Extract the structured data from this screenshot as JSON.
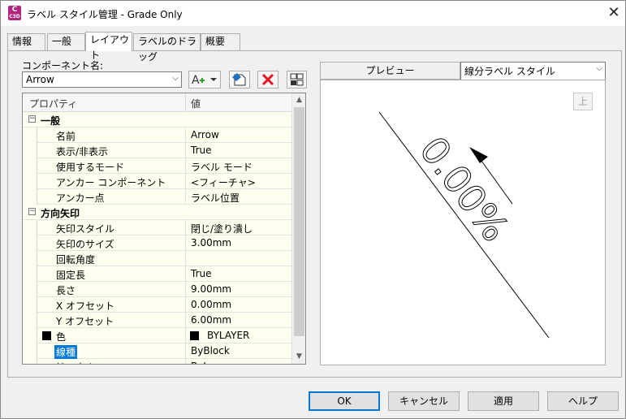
{
  "window": {
    "title": "ラベル スタイル管理 - Grade Only",
    "app_badge": "C",
    "app_badge_sub": "C3D",
    "close_glyph": "✕"
  },
  "tabs": [
    {
      "label": "情報"
    },
    {
      "label": "一般"
    },
    {
      "label": "レイアウト"
    },
    {
      "label": "ラベルのドラッグ"
    },
    {
      "label": "概要"
    }
  ],
  "active_tab": "レイアウト",
  "component": {
    "label": "コンポーネント名:",
    "value": "Arrow"
  },
  "toolbar": {
    "add_icon": "add-component-icon",
    "copy_icon": "copy-component-icon",
    "delete_icon": "delete-component-icon",
    "order_icon": "component-order-icon"
  },
  "grid": {
    "header_property": "プロパティ",
    "header_value": "値",
    "rows": [
      {
        "type": "cat",
        "name": "一般",
        "toggle": "−"
      },
      {
        "type": "prop",
        "name": "名前",
        "value": "Arrow"
      },
      {
        "type": "prop",
        "name": "表示/非表示",
        "value": "True"
      },
      {
        "type": "prop",
        "name": "使用するモード",
        "value": "ラベル モード"
      },
      {
        "type": "prop",
        "name": "アンカー コンポーネント",
        "value": "<フィーチャ>"
      },
      {
        "type": "prop",
        "name": "アンカー点",
        "value": "ラベル位置"
      },
      {
        "type": "cat",
        "name": "方向矢印",
        "toggle": "−"
      },
      {
        "type": "prop",
        "name": "矢印スタイル",
        "value": "閉じ/塗り潰し"
      },
      {
        "type": "prop",
        "name": "矢印のサイズ",
        "value": "3.00mm"
      },
      {
        "type": "prop",
        "name": "回転角度",
        "value": ""
      },
      {
        "type": "prop",
        "name": "固定長",
        "value": "True"
      },
      {
        "type": "prop",
        "name": "長さ",
        "value": "9.00mm"
      },
      {
        "type": "prop",
        "name": "X オフセット",
        "value": "0.00mm"
      },
      {
        "type": "prop",
        "name": "Y オフセット",
        "value": "6.00mm"
      },
      {
        "type": "prop",
        "name": "色",
        "value": "BYLAYER",
        "swatch": "#000000"
      },
      {
        "type": "prop",
        "name": "線種",
        "value": "ByBlock",
        "selected": true
      },
      {
        "type": "prop",
        "name": "線の太さ",
        "value": "ByLayer"
      }
    ]
  },
  "preview": {
    "header": "プレビュー",
    "style_select": "線分ラベル スタイル",
    "up_label": "上",
    "label_text": "0.00%"
  },
  "buttons": {
    "ok": "OK",
    "cancel": "キャンセル",
    "apply": "適用",
    "help": "ヘルプ"
  },
  "colors": {
    "accent": "#0078d7",
    "row_bg": "#fffff0",
    "delete_red": "#e81123",
    "app_icon": "#b3247e"
  }
}
